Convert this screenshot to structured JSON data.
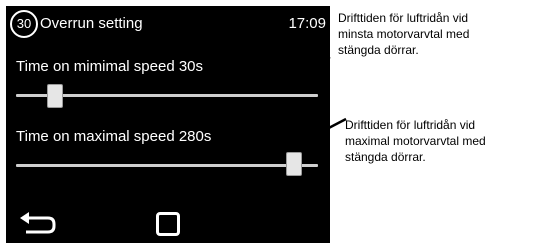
{
  "header": {
    "badge": "30",
    "title": "Overrun setting",
    "time": "17:09"
  },
  "settings": [
    {
      "label": "Time on mimimal speed 30s",
      "slider_fraction": 0.13
    },
    {
      "label": "Time on maximal speed 280s",
      "slider_fraction": 0.92
    }
  ],
  "annotations": [
    {
      "line1": "Drifttiden för luftridån vid",
      "line2": "minsta motorvarvtal med",
      "line3": "stängda dörrar."
    },
    {
      "line1": "Drifttiden för luftridån vid",
      "line2": "maximal motorvarvtal med",
      "line3": "stängda dörrar."
    }
  ],
  "icons": {
    "back": "back-arrow-icon",
    "home": "square-home-icon"
  },
  "colors": {
    "screen_background": "#000000",
    "text": "#ffffff",
    "slider_track": "#cfcfcf",
    "slider_thumb": "#e6e6e6"
  }
}
